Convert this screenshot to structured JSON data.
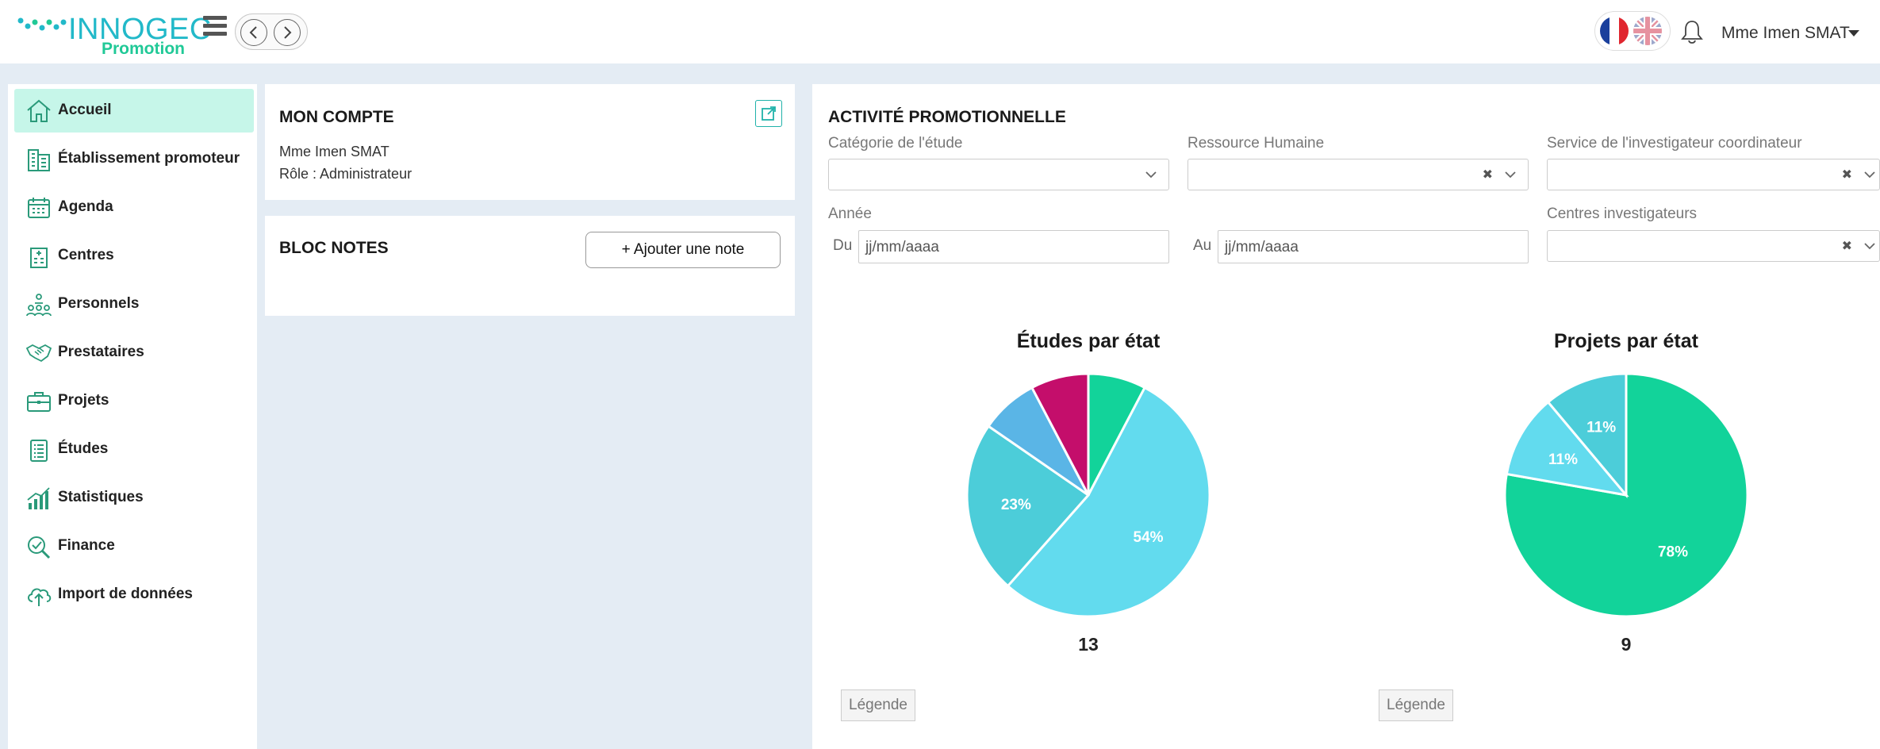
{
  "header": {
    "logo_text": "INNOGEC",
    "logo_subtitle": "Promotion",
    "user_name": "Mme Imen SMAT"
  },
  "sidebar": {
    "items": [
      {
        "label": "Accueil",
        "icon": "home-icon",
        "active": true
      },
      {
        "label": "Établissement promoteur",
        "icon": "building-icon"
      },
      {
        "label": "Agenda",
        "icon": "calendar-icon"
      },
      {
        "label": "Centres",
        "icon": "hospital-icon"
      },
      {
        "label": "Personnels",
        "icon": "people-icon"
      },
      {
        "label": "Prestataires",
        "icon": "handshake-icon"
      },
      {
        "label": "Projets",
        "icon": "briefcase-icon"
      },
      {
        "label": "Études",
        "icon": "clipboard-icon"
      },
      {
        "label": "Statistiques",
        "icon": "chart-icon"
      },
      {
        "label": "Finance",
        "icon": "finance-icon"
      },
      {
        "label": "Import de données",
        "icon": "cloud-upload-icon"
      }
    ]
  },
  "account": {
    "title": "MON COMPTE",
    "name": "Mme Imen SMAT",
    "role": "Rôle : Administrateur"
  },
  "notes": {
    "title": "BLOC NOTES",
    "add_label": "+ Ajouter une note"
  },
  "activity": {
    "title": "ACTIVITÉ PROMOTIONNELLE",
    "filters": {
      "category_label": "Catégorie de l'étude",
      "hr_label": "Ressource Humaine",
      "service_label": "Service de l'investigateur coordinateur",
      "year_label": "Année",
      "from_label": "Du",
      "to_label": "Au",
      "date_placeholder": "jj/mm/aaaa",
      "centers_label": "Centres investigateurs",
      "clear_symbol": "✖"
    },
    "legend_label": "Légende"
  },
  "colors": {
    "accent": "#20c997",
    "active_bg": "#c6f6e9",
    "page_bg": "#e4ecf4"
  },
  "chart_data": [
    {
      "type": "pie",
      "title": "Études par état",
      "total": "13",
      "slices": [
        {
          "value": 1,
          "label": "",
          "color": "#12d39a"
        },
        {
          "value": 7,
          "label": "54%",
          "color": "#62dbee"
        },
        {
          "value": 3,
          "label": "23%",
          "color": "#4ccdd9"
        },
        {
          "value": 1,
          "label": "",
          "color": "#5ab5e6"
        },
        {
          "value": 1,
          "label": "",
          "color": "#c40e6b"
        }
      ]
    },
    {
      "type": "pie",
      "title": "Projets par état",
      "total": "9",
      "slices": [
        {
          "value": 7,
          "label": "78%",
          "color": "#12d39a"
        },
        {
          "value": 1,
          "label": "11%",
          "color": "#62dbee"
        },
        {
          "value": 1,
          "label": "11%",
          "color": "#4ccdd9"
        }
      ]
    }
  ]
}
